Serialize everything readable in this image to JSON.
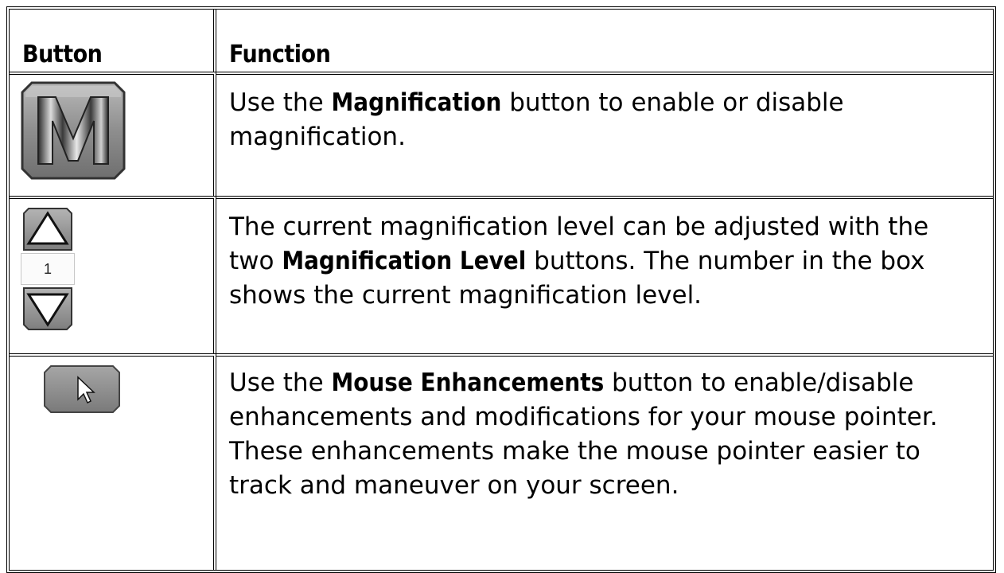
{
  "header": {
    "col_button": "Button",
    "col_function": "Function"
  },
  "rows": [
    {
      "icon": "magnification-m-icon",
      "text_before": "Use the ",
      "bold": "Magnification",
      "text_after": " button to enable or disable magnification."
    },
    {
      "icon": "magnification-level-stepper",
      "level_value": "1",
      "text_before": "The current magnification level can be adjusted with the two ",
      "bold": "Magnification Level",
      "text_after": " buttons. The number in the box shows the current magnification level."
    },
    {
      "icon": "mouse-pointer-icon",
      "text_before": "Use the ",
      "bold": "Mouse Enhancements",
      "text_after": " button to enable/disable enhancements and modifications for your mouse pointer. These enhancements make the mouse pointer easier to track and maneuver on your screen."
    }
  ],
  "colors": {
    "button_gray": "#8a8a8a",
    "button_dark": "#4a4a4a",
    "border": "#000000"
  }
}
